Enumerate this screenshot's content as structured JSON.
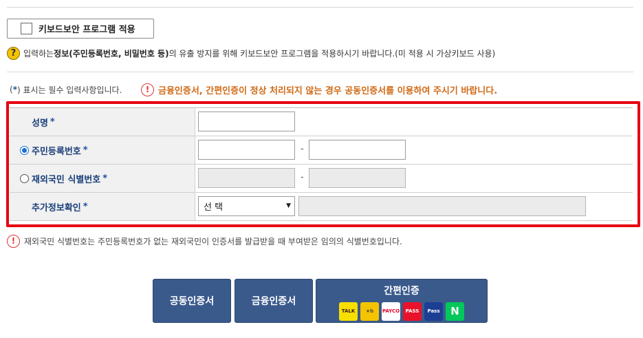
{
  "keyboard_security": {
    "button_label": "키보드보안 프로그램 적용",
    "info_prefix": "입력하는 ",
    "info_bold": "정보(주민등록번호, 비밀번호 등)",
    "info_suffix": "의 유출 방지를 위해 키보드보안 프로그램을 적용하시기 바랍니다.(미 적용 시 가상키보드 사용)"
  },
  "notice": {
    "required_open": "(",
    "required_star": "*",
    "required_close": ") 표시는 필수 입력사항입니다.",
    "warning": "금융인증서, 간편인증이 정상 처리되지 않는 경우 공동인증서를 이용하여 주시기 바랍니다."
  },
  "form": {
    "star": "*",
    "dash": "-",
    "name_label": "성명",
    "rrn_label": "주민등록번호",
    "foreign_label": "재외국민 식별번호",
    "extra_label": "추가정보확인",
    "extra_select_value": "선 택",
    "rrn_selected": true
  },
  "foot_note": "재외국민 식별번호는 주민등록번호가 없는 재외국민이 인증서를 발급받을 때 부여받은 임의의 식별번호입니다.",
  "buttons": {
    "joint_cert": "공동인증서",
    "financial_cert": "금융인증서",
    "simple_auth": "간편인증"
  },
  "simple_auth_logos": [
    {
      "name": "kakao-logo",
      "text": "TALK",
      "bg": "#f7e000",
      "fg": "#3a1d1d"
    },
    {
      "name": "kb-logo",
      "text": "★b",
      "bg": "#f4c400",
      "fg": "#5a4a3a"
    },
    {
      "name": "payco-logo",
      "text": "PAYCO",
      "bg": "#ffffff",
      "fg": "#e4002b"
    },
    {
      "name": "pass-logo",
      "text": "PASS",
      "bg": "#e8132a",
      "fg": "#ffffff"
    },
    {
      "name": "samsung-pass-logo",
      "text": "Pass",
      "bg": "#1c3f94",
      "fg": "#ffffff"
    },
    {
      "name": "naver-logo",
      "text": "N",
      "bg": "#03c75a",
      "fg": "#ffffff"
    }
  ]
}
